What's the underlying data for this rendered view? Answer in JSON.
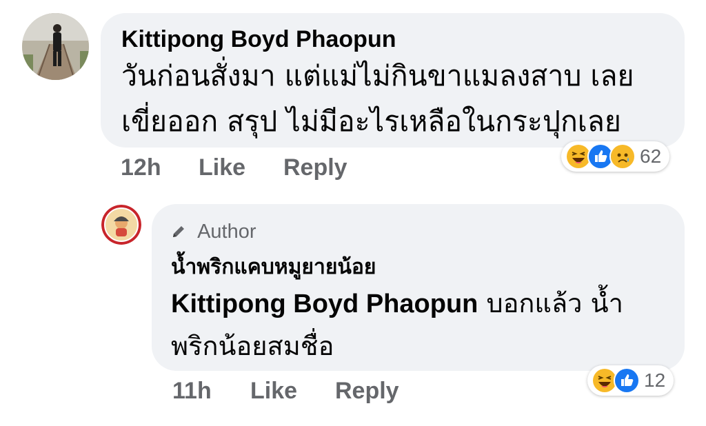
{
  "comment1": {
    "author": "Kittipong Boyd Phaopun",
    "line1": "วันก่อนสั่งมา แต่แม่ไม่กินขาแมลงสาบ เลย",
    "line2": "เขี่ยออก สรุป ไม่มีอะไรเหลือในกระปุกเลย",
    "time": "12h",
    "like_label": "Like",
    "reply_label": "Reply",
    "reaction_icons": [
      "haha-icon",
      "like-icon",
      "sad-icon"
    ],
    "reaction_count": "62"
  },
  "reply1": {
    "badge": "Author",
    "author": "น้ำพริกแคบหมูยายน้อย",
    "mention": "Kittipong Boyd Phaopun",
    "text_line1": " บอกแล้ว น้ำ",
    "text_line2": "พริกน้อยสมชื่อ",
    "time": "11h",
    "like_label": "Like",
    "reply_label": "Reply",
    "reaction_icons": [
      "haha-icon",
      "like-icon"
    ],
    "reaction_count": "12"
  },
  "colors": {
    "bubble_bg": "#f0f2f5",
    "meta_gray": "#65676b",
    "like_blue": "#1877f2",
    "haha_yellow": "#f7b928"
  }
}
